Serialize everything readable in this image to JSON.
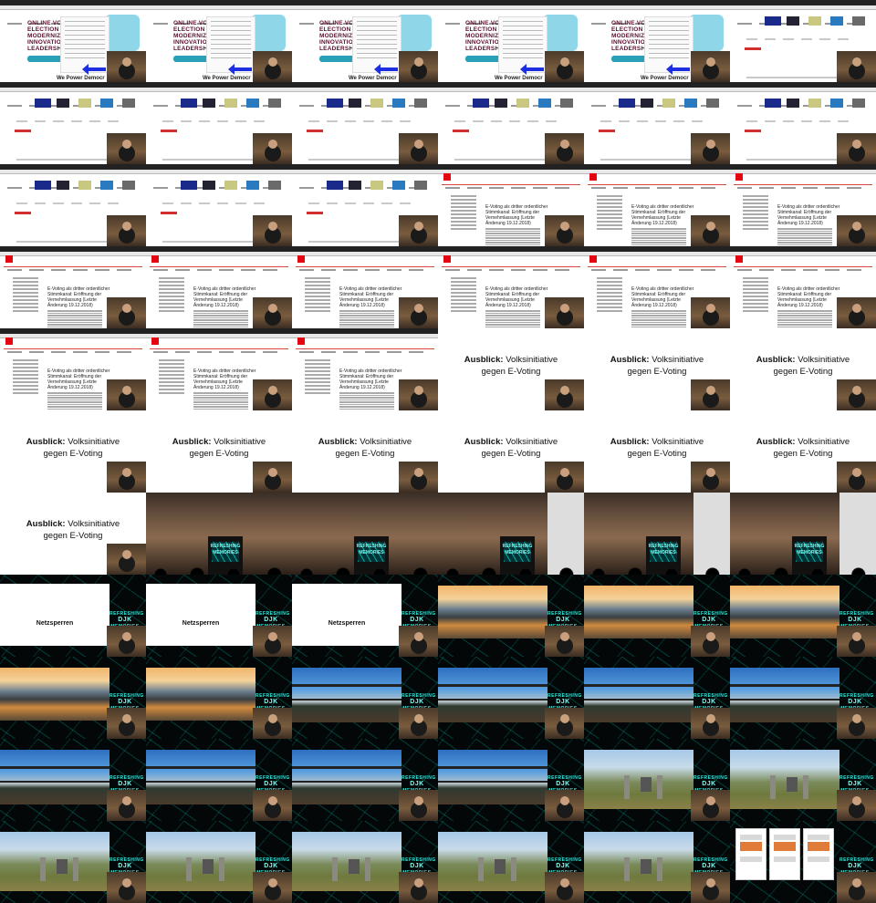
{
  "slides": {
    "hero_lines": [
      "ONLINE VOTI",
      "ELECTION",
      "MODERNIZA",
      "INNOVATION",
      "LEADERSHI"
    ],
    "hero_caption": "We Power Democr",
    "document_title": "E-Voting als dritter ordentlicher Stimmkanal: Eröffnung der Vernehmlassung (Letzte Änderung 19.12.2018)",
    "ausblick_bold": "Ausblick:",
    "ausblick_rest_line1": "Volksinitiative",
    "ausblick_line2": "gegen E-Voting",
    "netzsperren": "Netzsperren"
  },
  "branding": {
    "line1": "REFRESHING",
    "line2": "DJK",
    "line3": "MEMORIES",
    "accent_color": "#38e6d8"
  }
}
